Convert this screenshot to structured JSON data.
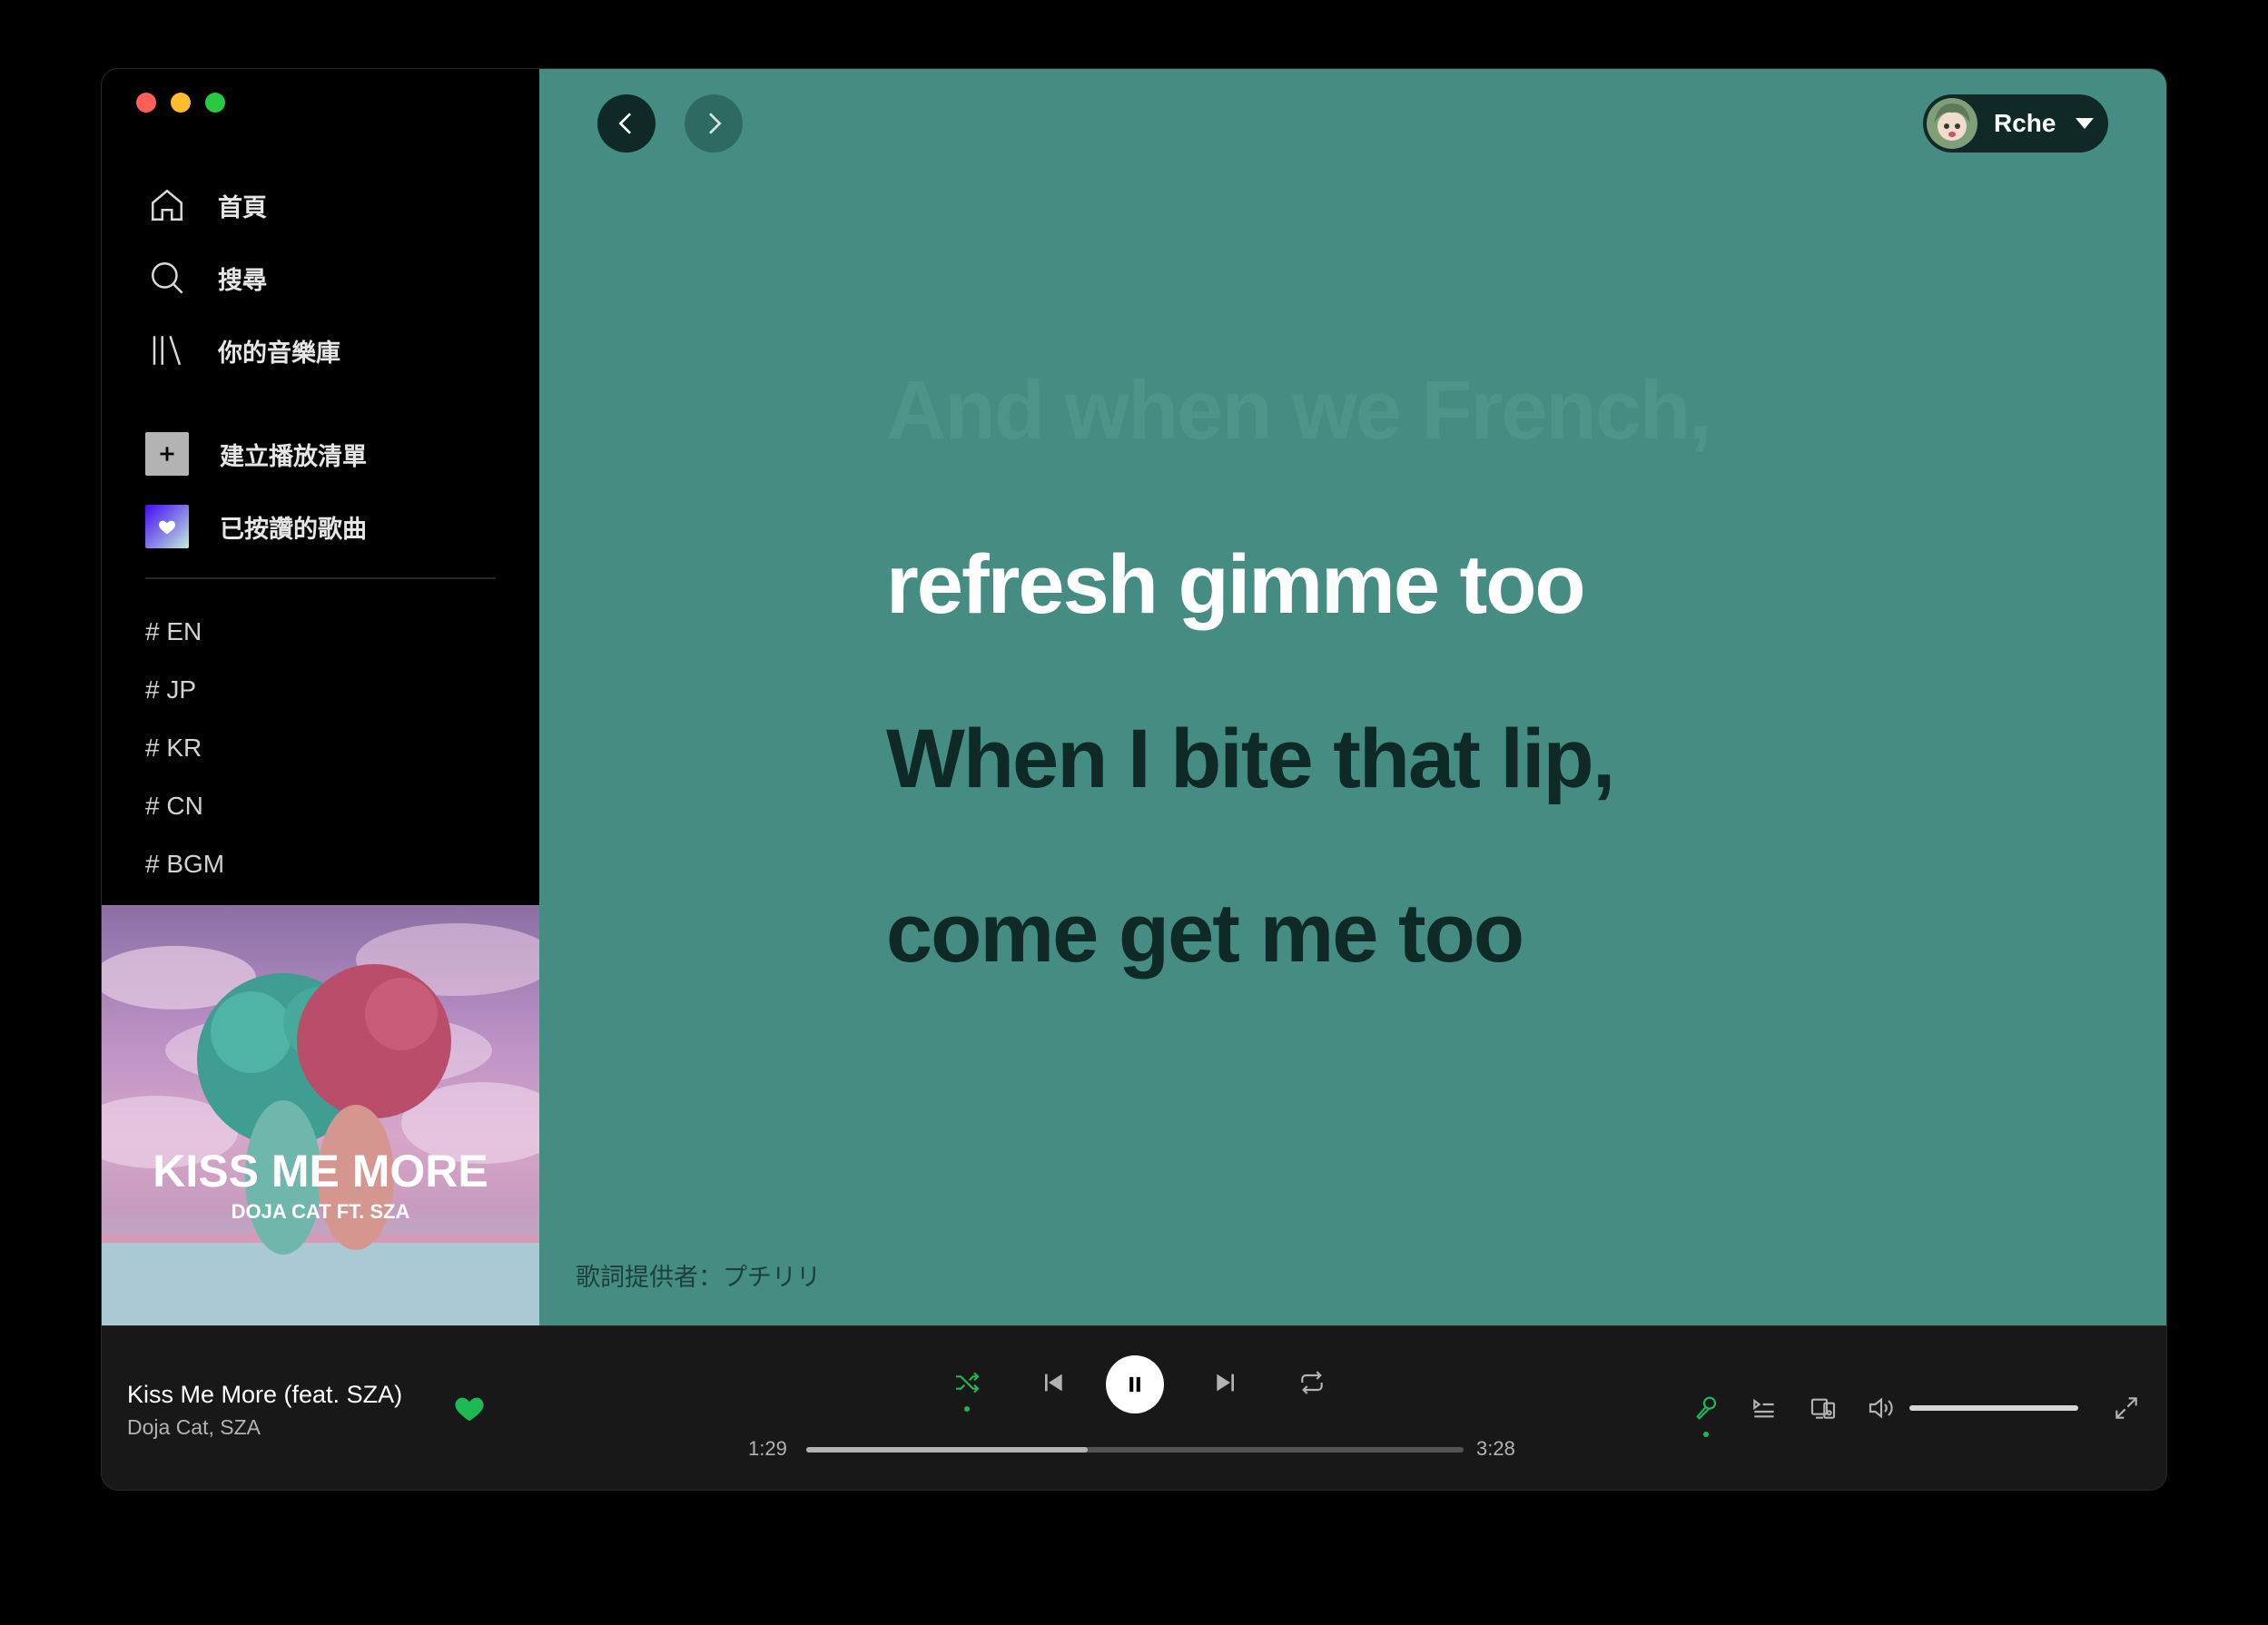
{
  "window": {
    "traffic_lights": [
      "#ff5f57",
      "#febc2e",
      "#28c840"
    ]
  },
  "sidebar": {
    "nav": [
      {
        "label": "首頁",
        "icon": "home-icon"
      },
      {
        "label": "搜尋",
        "icon": "search-icon"
      },
      {
        "label": "你的音樂庫",
        "icon": "library-icon"
      }
    ],
    "actions": [
      {
        "label": "建立播放清單",
        "icon": "plus-icon"
      },
      {
        "label": "已按讚的歌曲",
        "icon": "heart-icon"
      }
    ],
    "playlists": [
      "# EN",
      "# JP",
      "# KR",
      "# CN",
      "# BGM"
    ],
    "cover": {
      "title": "KISS ME MORE",
      "subtitle": "DOJA CAT FT. SZA"
    }
  },
  "header": {
    "back_icon": "chevron-left-icon",
    "forward_icon": "chevron-right-icon",
    "user_name": "Rche"
  },
  "lyrics": {
    "lines": [
      {
        "text": "And when we French,",
        "state": "past"
      },
      {
        "text": "refresh gimme too",
        "state": "current"
      },
      {
        "text": "When I bite that lip,",
        "state": "upcoming"
      },
      {
        "text": "come get me too",
        "state": "upcoming"
      }
    ],
    "provider": "歌詞提供者：プチリリ",
    "colors": {
      "background": "#458d82",
      "past": "#4c9588",
      "current": "#ffffff",
      "upcoming": "#0f2a26"
    }
  },
  "player": {
    "track_title": "Kiss Me More (feat. SZA)",
    "track_artist": "Doja Cat, SZA",
    "liked": true,
    "elapsed": "1:29",
    "duration": "3:28",
    "progress_fraction": 0.428,
    "volume_fraction": 1.0,
    "shuffle_on": true,
    "lyrics_on": true,
    "accent": "#1db954"
  }
}
